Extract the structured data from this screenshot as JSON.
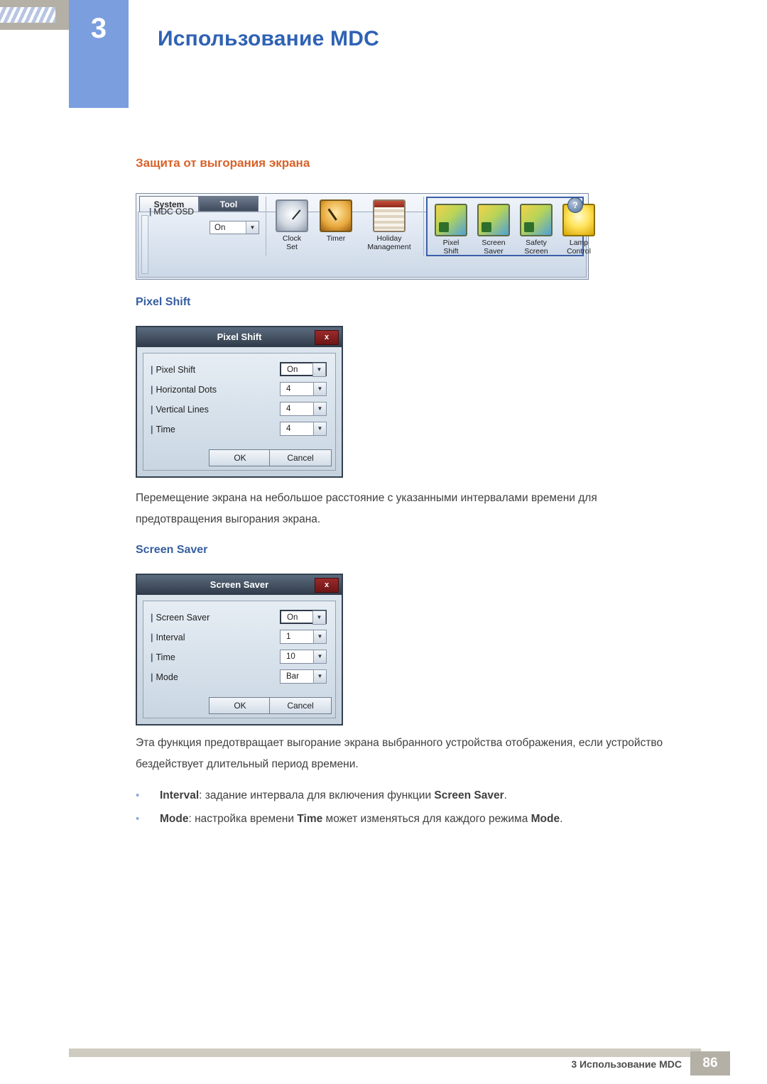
{
  "header": {
    "chapter_number": "3",
    "title": "Использование MDC"
  },
  "section": {
    "title": "Защита от выгорания экрана"
  },
  "toolbar": {
    "tabs": [
      {
        "label": "System",
        "active": true
      },
      {
        "label": "Tool",
        "active": false
      }
    ],
    "osd_label": "MDC OSD",
    "osd_value": "On",
    "help_label": "?",
    "icons": [
      {
        "line1": "Clock",
        "line2": "Set"
      },
      {
        "line1": "Timer",
        "line2": ""
      },
      {
        "line1": "Holiday",
        "line2": "Management"
      },
      {
        "line1": "Pixel",
        "line2": "Shift"
      },
      {
        "line1": "Screen",
        "line2": "Saver"
      },
      {
        "line1": "Safety",
        "line2": "Screen"
      },
      {
        "line1": "Lamp",
        "line2": "Control"
      }
    ]
  },
  "pixel_shift": {
    "heading": "Pixel Shift",
    "dialog_title": "Pixel Shift",
    "close_label": "x",
    "rows": [
      {
        "label": "Pixel Shift",
        "value": "On"
      },
      {
        "label": "Horizontal Dots",
        "value": "4"
      },
      {
        "label": "Vertical Lines",
        "value": "4"
      },
      {
        "label": "Time",
        "value": "4"
      }
    ],
    "ok_label": "OK",
    "cancel_label": "Cancel",
    "paragraph": "Перемещение экрана на небольшое расстояние с указанными интервалами времени для предотвращения выгорания экрана."
  },
  "screen_saver": {
    "heading": "Screen Saver",
    "dialog_title": "Screen Saver",
    "close_label": "x",
    "rows": [
      {
        "label": "Screen Saver",
        "value": "On"
      },
      {
        "label": "Interval",
        "value": "1"
      },
      {
        "label": "Time",
        "value": "10"
      },
      {
        "label": "Mode",
        "value": "Bar"
      }
    ],
    "ok_label": "OK",
    "cancel_label": "Cancel",
    "paragraph": "Эта функция предотвращает выгорание экрана выбранного устройства отображения, если устройство бездействует длительный период времени.",
    "bullets": [
      {
        "bold1": "Interval",
        "text1": ": задание интервала для включения функции ",
        "bold2": "Screen Saver",
        "text2": "."
      },
      {
        "bold1": "Mode",
        "text1": ": настройка времени ",
        "bold2": "Time",
        "text2": " может изменяться для каждого режима ",
        "bold3": "Mode",
        "text3": "."
      }
    ]
  },
  "footer": {
    "text": "3 Использование MDC",
    "page": "86"
  }
}
